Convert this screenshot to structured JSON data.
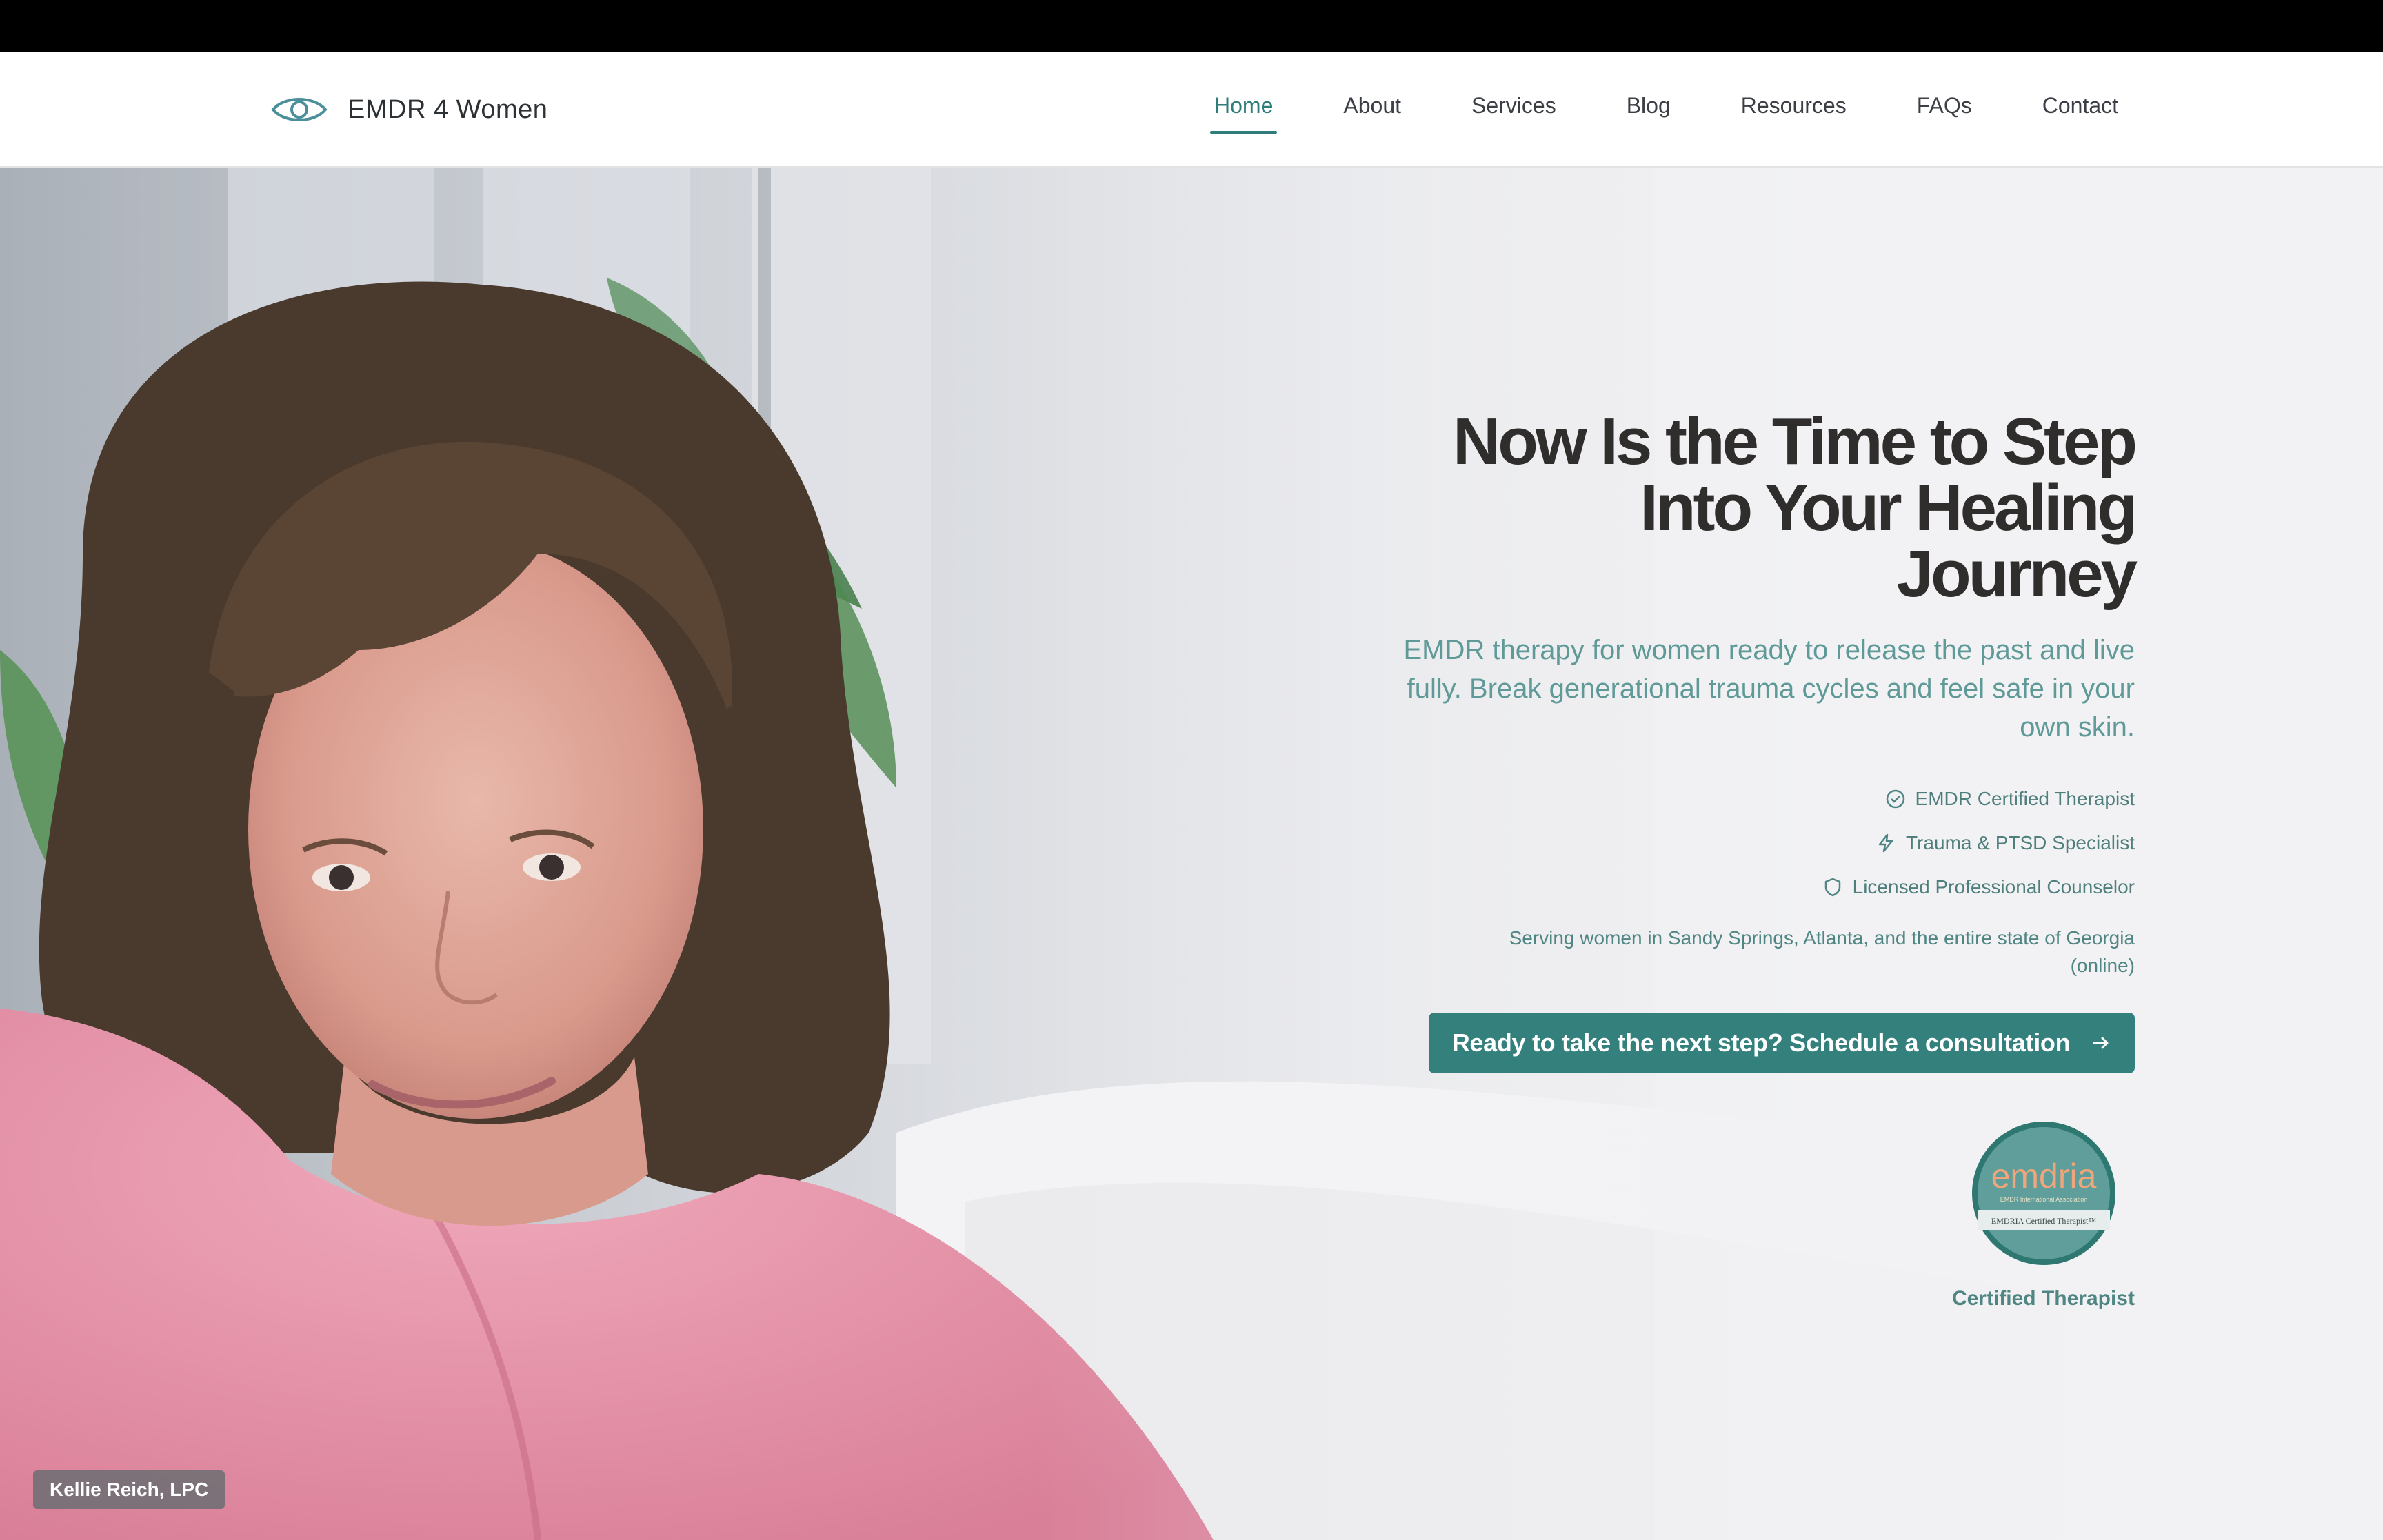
{
  "brand": {
    "name": "EMDR 4 Women",
    "logo_icon": "eye-icon"
  },
  "nav": {
    "items": [
      {
        "label": "Home",
        "active": true
      },
      {
        "label": "About",
        "active": false
      },
      {
        "label": "Services",
        "active": false
      },
      {
        "label": "Blog",
        "active": false
      },
      {
        "label": "Resources",
        "active": false
      },
      {
        "label": "FAQs",
        "active": false
      },
      {
        "label": "Contact",
        "active": false
      }
    ]
  },
  "hero": {
    "headline_lines": [
      "Now Is the Time to Step",
      "Into Your Healing",
      "Journey"
    ],
    "subtitle": "EMDR therapy for women ready to release the past and live fully. Break generational trauma cycles and feel safe in your own skin.",
    "badges": [
      {
        "icon": "check-circle-icon",
        "label": "EMDR Certified Therapist"
      },
      {
        "icon": "lightning-icon",
        "label": "Trauma & PTSD Specialist"
      },
      {
        "icon": "shield-icon",
        "label": "Licensed Professional Counselor"
      }
    ],
    "serving": "Serving women in Sandy Springs, Atlanta, and the entire state of Georgia (online)",
    "cta_label": "Ready to take the next step? Schedule a consultation",
    "cta_icon": "arrow-right-icon",
    "cert": {
      "seal_word": "emdria",
      "seal_small": "EMDR International Association",
      "seal_banner": "EMDRIA Certified Therapist™",
      "label": "Certified Therapist"
    },
    "photo_caption": "Kellie Reich, LPC"
  },
  "colors": {
    "accent": "#34807d",
    "accent_text": "#5f9a98",
    "headline": "#2f2e2c",
    "shirt_pink": "#e48fa6",
    "hair_brown": "#4a3a2e"
  }
}
